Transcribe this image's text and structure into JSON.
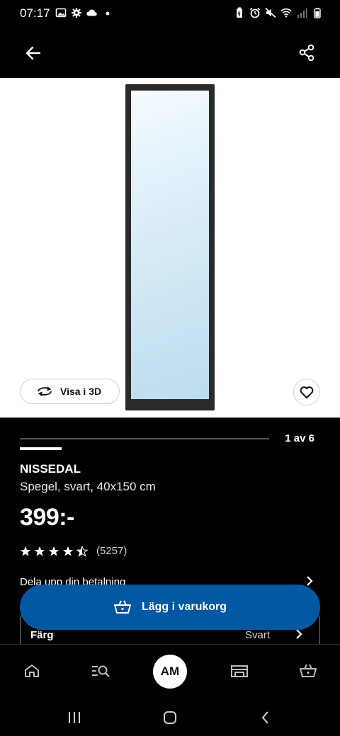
{
  "status_bar": {
    "time": "07:17",
    "left_icons": [
      "image-icon",
      "gear-icon",
      "cloud-icon",
      "dot-icon"
    ],
    "right_icons": [
      "battery-saver-icon",
      "alarm-icon",
      "mute-icon",
      "wifi-icon",
      "signal-icon",
      "battery-icon"
    ]
  },
  "app_bar": {
    "back_icon": "arrow-left-icon",
    "share_icon": "share-icon"
  },
  "gallery": {
    "view_3d_label": "Visa i 3D",
    "favorite_icon": "heart-icon",
    "page_current": 1,
    "page_total": 6,
    "page_label": "1 av 6"
  },
  "product": {
    "name": "NISSEDAL",
    "description": "Spegel, svart, 40x150 cm",
    "price": "399:-",
    "rating_value": 4.5,
    "rating_max": 5,
    "rating_count": "(5257)"
  },
  "installment": {
    "label": "Dela upp din betalning"
  },
  "color": {
    "label": "Färg",
    "value": "Svart"
  },
  "cart": {
    "button_label": "Lägg i varukorg",
    "icon": "basket-icon"
  },
  "bottom_nav": {
    "items": [
      {
        "name": "home",
        "icon": "home-icon"
      },
      {
        "name": "search",
        "icon": "search-list-icon"
      },
      {
        "name": "profile",
        "label": "AM"
      },
      {
        "name": "store",
        "icon": "store-icon"
      },
      {
        "name": "cart",
        "icon": "basket-icon"
      }
    ]
  },
  "colors": {
    "primary_button": "#0058a3",
    "background": "#000000",
    "image_background": "#ffffff"
  }
}
